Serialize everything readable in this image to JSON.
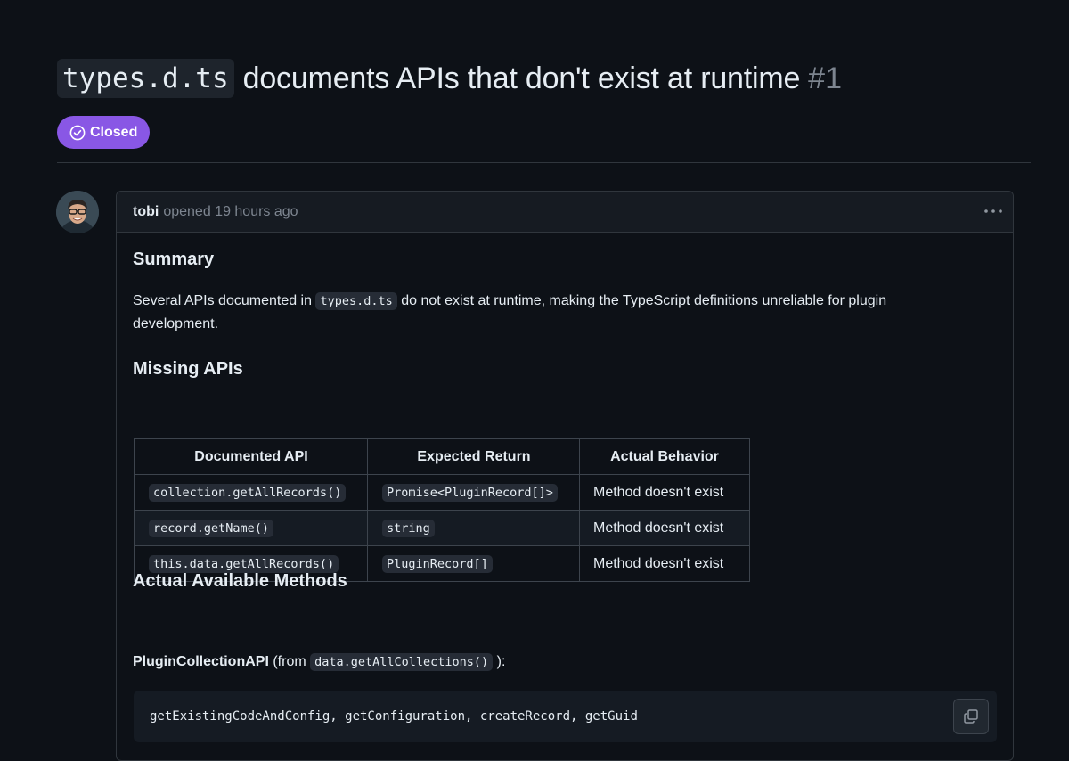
{
  "issue": {
    "title_code": "types.d.ts",
    "title_text": "documents APIs that don't exist at runtime",
    "number": "#1",
    "state": "Closed",
    "state_color": "#8957e5"
  },
  "comment": {
    "author": "tobi",
    "opened_text": "opened 19 hours ago",
    "summary_heading": "Summary",
    "summary_pre": "Several APIs documented in",
    "summary_code": "types.d.ts",
    "summary_post": "do not exist at runtime, making the TypeScript definitions unreliable for plugin development.",
    "missing_heading": "Missing APIs",
    "table": {
      "headers": [
        "Documented API",
        "Expected Return",
        "Actual Behavior"
      ],
      "rows": [
        [
          "collection.getAllRecords()",
          "Promise<PluginRecord[]>",
          "Method doesn't exist"
        ],
        [
          "record.getName()",
          "string",
          "Method doesn't exist"
        ],
        [
          "this.data.getAllRecords()",
          "PluginRecord[]",
          "Method doesn't exist"
        ]
      ]
    },
    "available_heading": "Actual Available Methods",
    "collection_api_label": "PluginCollectionAPI",
    "collection_api_from": "(from",
    "collection_api_code": "data.getAllCollections()",
    "collection_api_close": "):",
    "code_block": "getExistingCodeAndConfig, getConfiguration, createRecord, getGuid"
  },
  "icons": {
    "state": "check-circle-icon",
    "menu": "kebab-horizontal-icon",
    "copy": "copy-icon"
  }
}
